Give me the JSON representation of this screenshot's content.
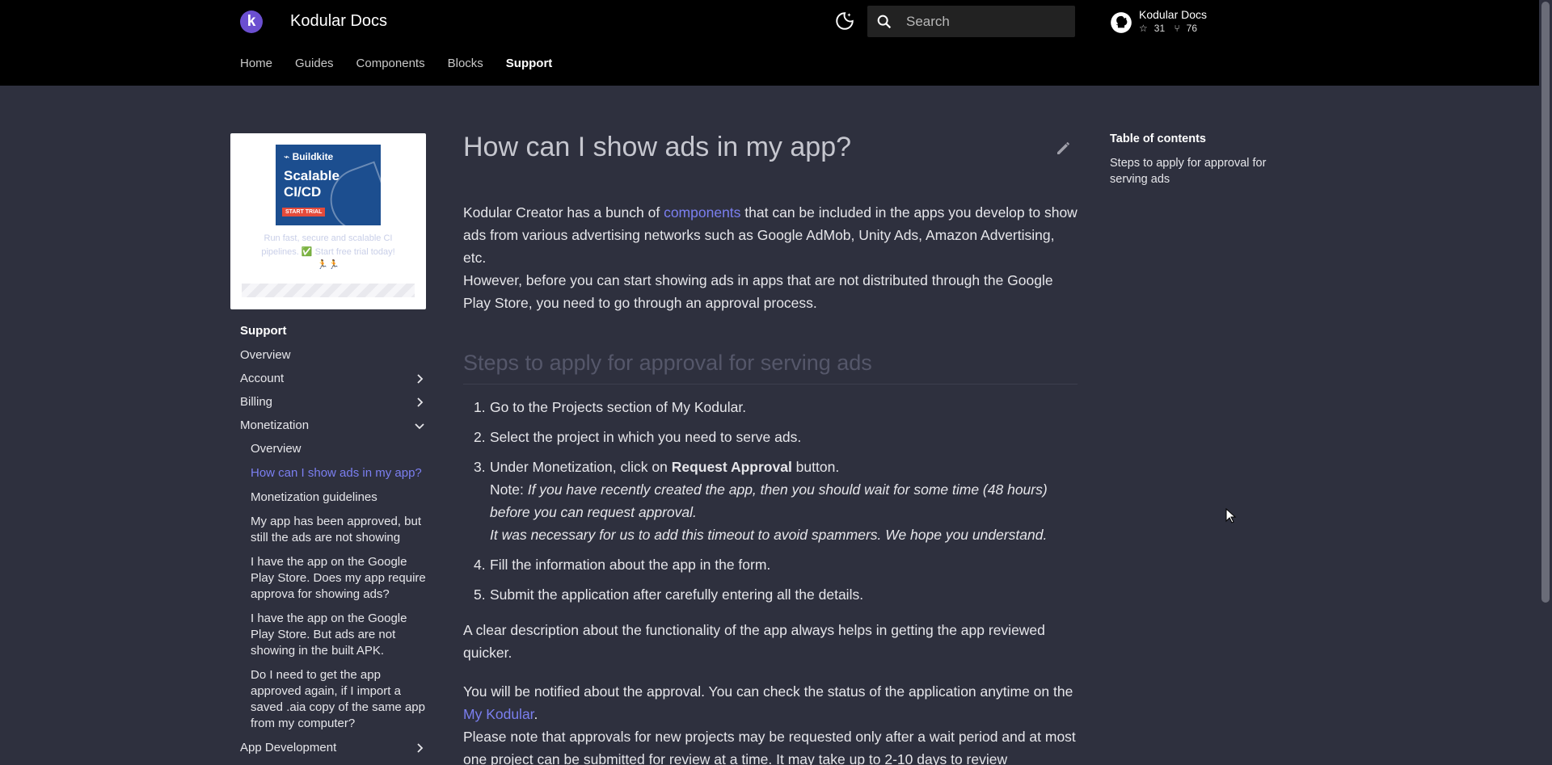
{
  "header": {
    "logo_letter": "k",
    "site_title": "Kodular Docs",
    "search_placeholder": "Search",
    "repo_name": "Kodular Docs",
    "repo_stars": "31",
    "repo_forks": "76"
  },
  "tabs": [
    "Home",
    "Guides",
    "Components",
    "Blocks",
    "Support"
  ],
  "ad": {
    "brand": "Buildkite",
    "headline_1": "Scalable",
    "headline_2": "CI/CD",
    "cta": "START TRIAL",
    "text": "Run fast, secure and scalable CI pipelines. ✅ Start free trial today!",
    "emoji": "🏃🏃"
  },
  "sidebar": {
    "heading": "Support",
    "items": {
      "overview": "Overview",
      "account": "Account",
      "billing": "Billing",
      "monetization": "Monetization",
      "app_development": "App Development"
    },
    "monetization_items": [
      "Overview",
      "How can I show ads in my app?",
      "Monetization guidelines",
      "My app has been approved, but still the ads are not showing",
      "I have the app on the Google Play Store. Does my app require approva for showing ads?",
      "I have the app on the Google Play Store. But ads are not showing in the built APK.",
      "Do I need to get the app approved again, if I import a saved .aia copy of the same app from my computer?"
    ]
  },
  "main": {
    "title": "How can I show ads in my app?",
    "p1_a": "Kodular Creator has a bunch of ",
    "p1_link": "components",
    "p1_b": " that can be included in the apps you develop to show ads from various advertising networks such as Google AdMob, Unity Ads, Amazon Advertising, etc.",
    "p1_c": "However, before you can start showing ads in apps that are not distributed through the Google Play Store, you need to go through an approval process.",
    "h2": "Steps to apply for approval for serving ads",
    "steps": {
      "s1": "Go to the Projects section of My Kodular.",
      "s2": "Select the project in which you need to serve ads.",
      "s3_a": "Under Monetization, click on ",
      "s3_bold": "Request Approval",
      "s3_b": " button.",
      "s3_note_label": "Note: ",
      "s3_note_1": "If you have recently created the app, then you should wait for some time (48 hours) before you can request approval.",
      "s3_note_2": "It was necessary for us to add this timeout to avoid spammers. We hope you understand.",
      "s4": "Fill the information about the app in the form.",
      "s5": "Submit the application after carefully entering all the details."
    },
    "p2": "A clear description about the functionality of the app always helps in getting the app reviewed quicker.",
    "p3_a": "You will be notified about the approval. You can check the status of the application anytime on the ",
    "p3_link": "My Kodular",
    "p3_b": ".",
    "p3_c": "Please note that approvals for new projects may be requested only after a wait period and at most one project can be submitted for review at a time. It may take up to 2-10 days to review"
  },
  "toc": {
    "title": "Table of contents",
    "items": [
      "Steps to apply for approval for serving ads"
    ]
  },
  "colors": {
    "header_bg": "#000000",
    "body_bg": "#2e303e",
    "accent": "#7b7ff0",
    "logo": "#6b4fd0"
  }
}
